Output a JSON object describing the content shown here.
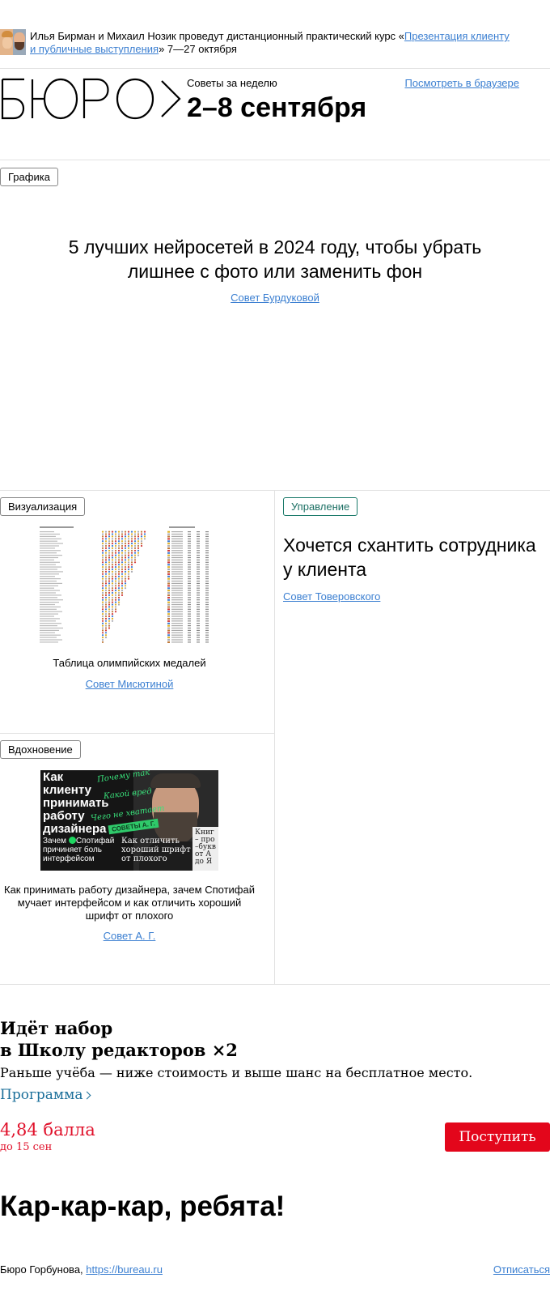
{
  "announcement": {
    "prefix": "Илья Бирман и Михаил Нозик проведут дистанционный практический курс «",
    "link": "Презентация клиенту и публичные выступления",
    "suffix": "» 7—27 октября"
  },
  "header": {
    "logo_text": "БЮРО",
    "kicker": "Советы за неделю",
    "title": "2–8 сентября",
    "browser_link": "Посмотреть в браузере"
  },
  "hero": {
    "tag": "Графика",
    "title": "5 лучших нейросетей в 2024 году, чтобы убрать лишнее с фото или заменить фон",
    "author": "Совет Бурдуковой"
  },
  "cards": {
    "visualization": {
      "tag": "Визуализация",
      "caption": "Таблица олимпийских медалей",
      "author": "Совет Мисютиной"
    },
    "management": {
      "tag": "Управление",
      "title": "Хочется схантить сотрудника у клиента",
      "author": "Совет Товеровского"
    },
    "inspiration": {
      "tag": "Вдохновение",
      "image_text": {
        "main": [
          "Как",
          "клиенту",
          "принимать",
          "работу",
          "дизайнера"
        ],
        "script1": "Почему так",
        "script2": "Какой вред",
        "script3": "Чего не хватает",
        "badge": "СОВЕТЫ А. Г.",
        "bottom_left": [
          "Зачем",
          "Спотифай",
          "причиняет боль",
          "интерфейсом"
        ],
        "bottom_right": [
          "Как отличить",
          "хороший шрифт",
          "от плохого"
        ],
        "book": [
          "Книг",
          "– про",
          "–букв",
          "от А",
          "до Я"
        ]
      },
      "caption": "Как принимать работу дизайнера, зачем Спотифай мучает интерфейсом и как отличить хороший шрифт от плохого",
      "author": "Совет А. Г."
    }
  },
  "promo": {
    "title_line1": "Идёт набор",
    "title_line2": "в Школу редакторов ×2",
    "subtitle": "Раньше учёба — ниже стоимость и выше шанс на бесплатное место.",
    "link": "Программа",
    "score": "4,84 балла",
    "deadline": "до 15 сен",
    "button": "Поступить",
    "accent": "#e3061b"
  },
  "sign_off": "Кар-кар-кар, ребята!",
  "footer": {
    "company": "Бюро Горбунова, ",
    "site": "https://bureau.ru",
    "unsubscribe": "Отписаться"
  }
}
